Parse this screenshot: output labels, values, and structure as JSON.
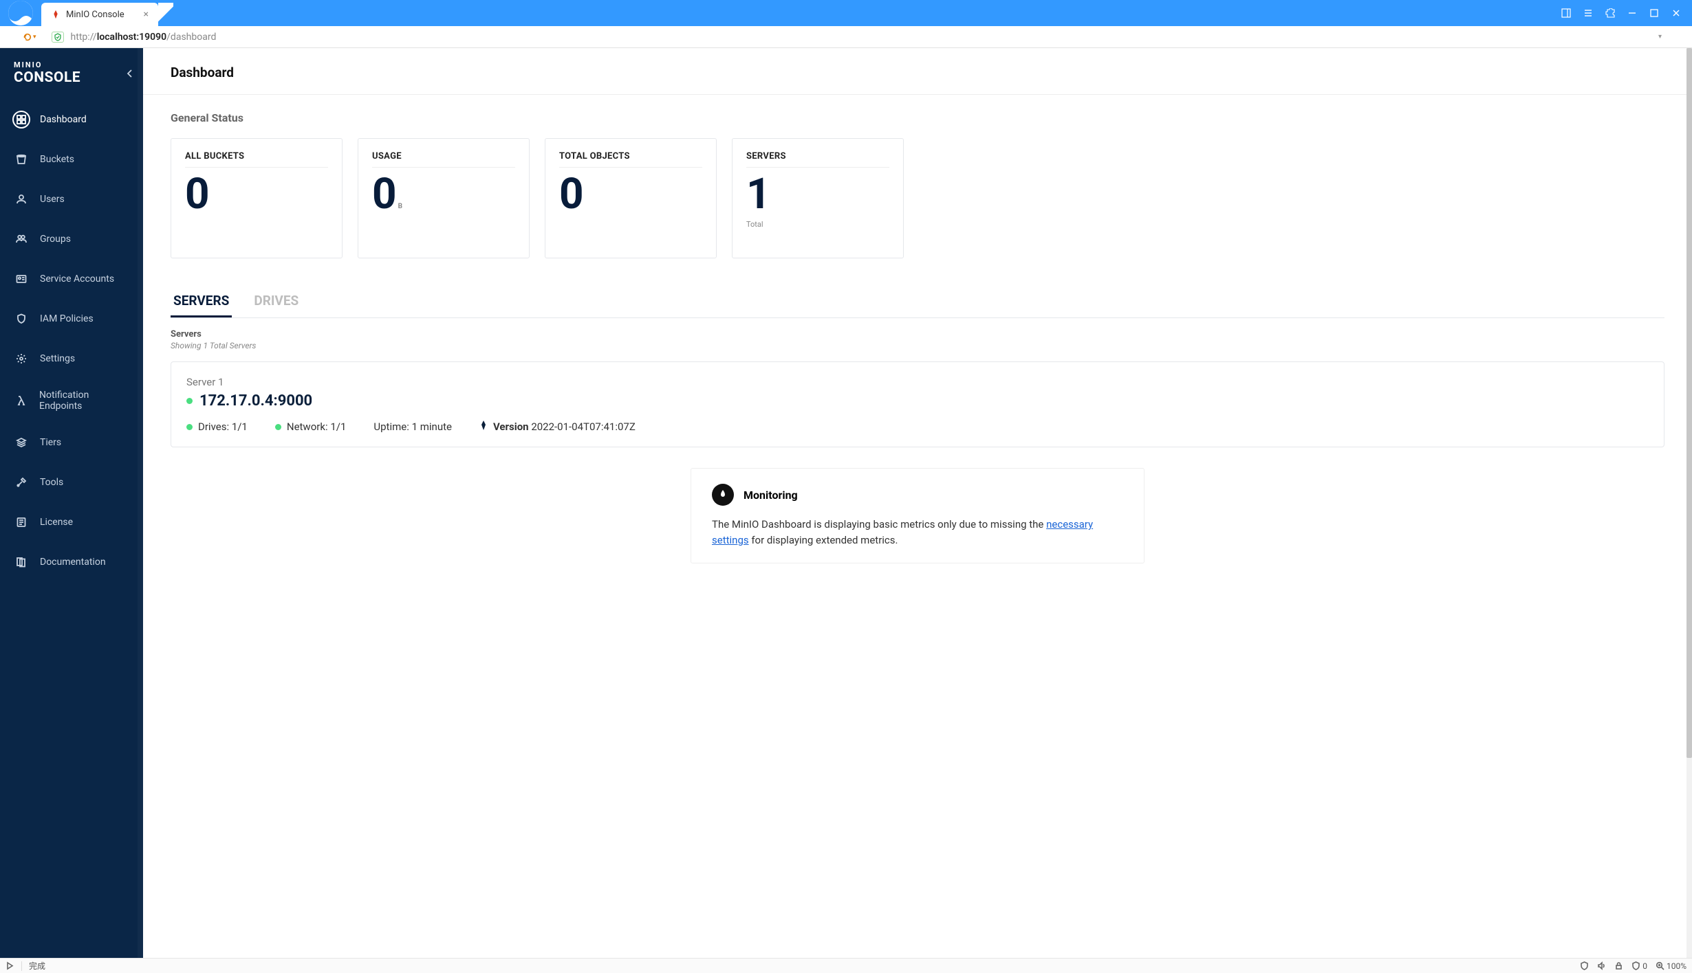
{
  "browser": {
    "tab_title": "MinIO Console",
    "url_display_prefix": "http://",
    "url_host": "localhost:19090",
    "url_path": "/dashboard"
  },
  "brand": {
    "line1": "MINIO",
    "line2": "CONSOLE"
  },
  "sidebar": {
    "items": [
      {
        "label": "Dashboard",
        "icon": "dashboard-icon",
        "active": true
      },
      {
        "label": "Buckets",
        "icon": "bucket-icon"
      },
      {
        "label": "Users",
        "icon": "user-icon"
      },
      {
        "label": "Groups",
        "icon": "group-icon"
      },
      {
        "label": "Service Accounts",
        "icon": "id-icon"
      },
      {
        "label": "IAM Policies",
        "icon": "shield-icon"
      },
      {
        "label": "Settings",
        "icon": "gear-icon"
      },
      {
        "label": "Notification Endpoints",
        "icon": "lambda-icon"
      },
      {
        "label": "Tiers",
        "icon": "layers-icon"
      },
      {
        "label": "Tools",
        "icon": "tools-icon"
      },
      {
        "label": "License",
        "icon": "license-icon"
      },
      {
        "label": "Documentation",
        "icon": "doc-icon"
      }
    ]
  },
  "page": {
    "title": "Dashboard",
    "general_status": "General Status",
    "cards": [
      {
        "label": "ALL BUCKETS",
        "value": "0",
        "suffix": "",
        "sub": ""
      },
      {
        "label": "USAGE",
        "value": "0",
        "suffix": "B",
        "sub": ""
      },
      {
        "label": "TOTAL OBJECTS",
        "value": "0",
        "suffix": "",
        "sub": ""
      },
      {
        "label": "SERVERS",
        "value": "1",
        "suffix": "",
        "sub": "Total"
      }
    ],
    "tabs": [
      "SERVERS",
      "DRIVES"
    ],
    "active_tab": "SERVERS",
    "servers_section": {
      "heading": "Servers",
      "showing": "Showing 1 Total Servers",
      "servers": [
        {
          "name": "Server 1",
          "address": "172.17.0.4:9000",
          "drives_label": "Drives:",
          "drives": "1/1",
          "network_label": "Network:",
          "network": "1/1",
          "uptime_label": "Uptime:",
          "uptime": "1 minute",
          "version_label": "Version",
          "version": "2022-01-04T07:41:07Z"
        }
      ]
    },
    "notice": {
      "title": "Monitoring",
      "text_before": "The MinIO Dashboard is displaying basic metrics only due to missing the ",
      "link_text": "necessary settings",
      "text_after": " for displaying extended metrics."
    }
  },
  "statusbar": {
    "left": "完成",
    "shield_count": "0",
    "zoom": "100%"
  }
}
